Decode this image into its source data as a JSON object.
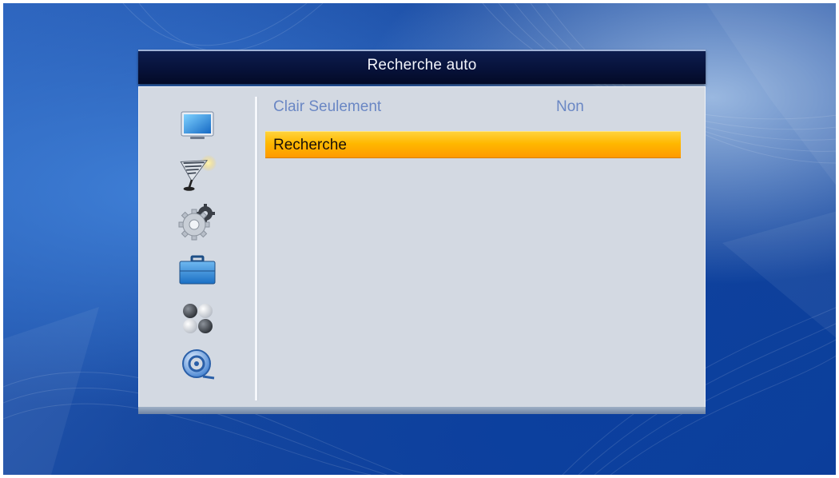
{
  "window": {
    "title": "Recherche auto"
  },
  "sidebar": {
    "icons": [
      {
        "name": "tv-icon"
      },
      {
        "name": "satellite-dish-icon"
      },
      {
        "name": "settings-gear-icon"
      },
      {
        "name": "toolbox-icon"
      },
      {
        "name": "dots-icon"
      },
      {
        "name": "media-disc-icon"
      }
    ]
  },
  "menu": {
    "items": [
      {
        "label": "Clair Seulement",
        "value": "Non",
        "selected": false
      },
      {
        "label": "Recherche",
        "value": "",
        "selected": true
      }
    ]
  },
  "colors": {
    "title_bar": "#07123a",
    "panel": "#d3d9e2",
    "highlight": "#ffb800",
    "item_text": "#6a87c4"
  }
}
